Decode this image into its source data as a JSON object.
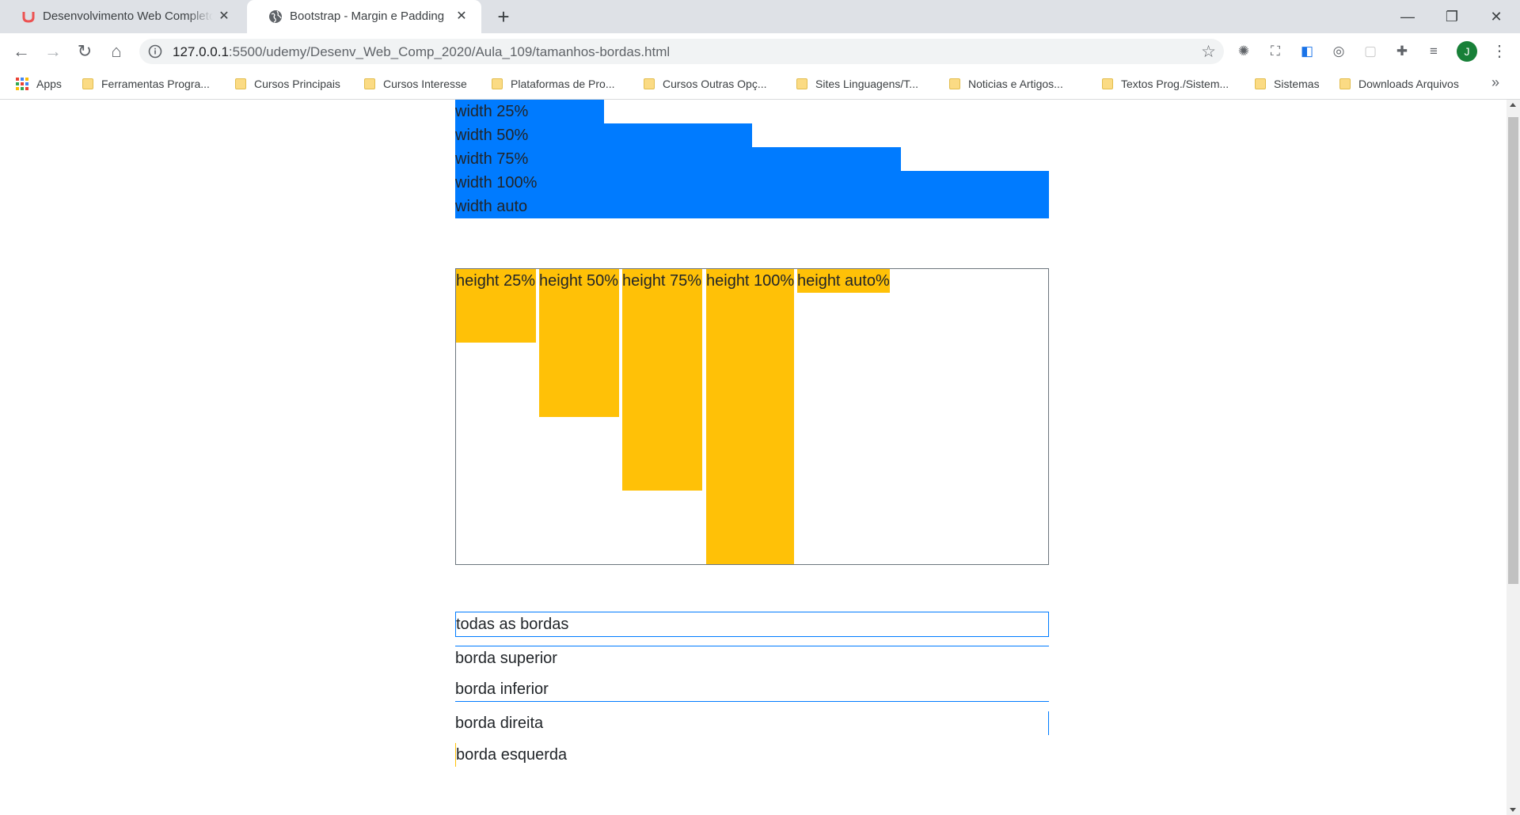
{
  "browser": {
    "tabs": [
      {
        "title": "Desenvolvimento Web Completo",
        "icon": "udemy-icon",
        "active": false
      },
      {
        "title": "Bootstrap - Margin e Padding",
        "icon": "globe-icon",
        "active": true
      }
    ],
    "url": {
      "host": "127.0.0.1",
      "rest": ":5500/udemy/Desenv_Web_Comp_2020/Aula_109/tamanhos-bordas.html"
    },
    "profile_initial": "J",
    "bookmarks": [
      {
        "label": "Apps"
      },
      {
        "label": "Ferramentas Progra..."
      },
      {
        "label": "Cursos Principais"
      },
      {
        "label": "Cursos Interesse"
      },
      {
        "label": "Plataformas de Pro..."
      },
      {
        "label": "Cursos Outras Opç..."
      },
      {
        "label": "Sites Linguagens/T..."
      },
      {
        "label": "Noticias e Artigos..."
      },
      {
        "label": "Textos Prog./Sistem..."
      },
      {
        "label": "Sistemas"
      },
      {
        "label": "Downloads Arquivos"
      }
    ]
  },
  "page": {
    "width_boxes": [
      {
        "label": "width 25%",
        "fraction": 0.25
      },
      {
        "label": "width 50%",
        "fraction": 0.5
      },
      {
        "label": "width 75%",
        "fraction": 0.75
      },
      {
        "label": "width 100%",
        "fraction": 1.0
      },
      {
        "label": "width auto",
        "fraction": 1.0
      }
    ],
    "height_boxes": [
      {
        "label": "height 25%",
        "fraction": 0.25
      },
      {
        "label": "height 50%",
        "fraction": 0.5
      },
      {
        "label": "height 75%",
        "fraction": 0.75
      },
      {
        "label": "height 100%",
        "fraction": 1.0
      },
      {
        "label": "height auto%",
        "fraction": null
      }
    ],
    "border_boxes": [
      {
        "label": "todas as bordas",
        "side": "all",
        "color": "#007bff"
      },
      {
        "label": "borda superior",
        "side": "top",
        "color": "#007bff"
      },
      {
        "label": "borda inferior",
        "side": "bottom",
        "color": "#007bff"
      },
      {
        "label": "borda direita",
        "side": "right",
        "color": "#007bff"
      },
      {
        "label": "borda esquerda",
        "side": "left",
        "color": "#ffc107"
      }
    ],
    "colors": {
      "primary": "#007bff",
      "warning": "#ffc107",
      "text": "#212529",
      "border_secondary": "#6c757d"
    }
  }
}
